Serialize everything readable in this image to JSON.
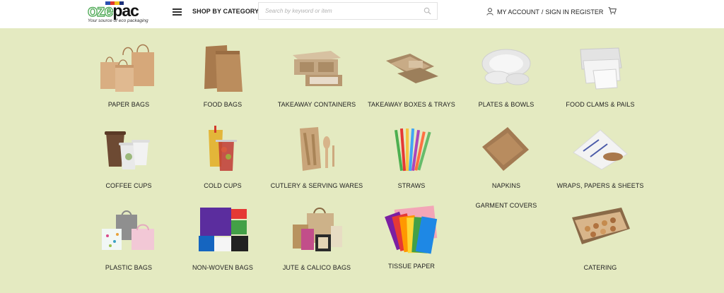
{
  "brand": {
    "logo_part1": "oze",
    "logo_part2": "pac",
    "tagline": "Your source of eco packaging",
    "square_colors": [
      "#2a4fb0",
      "#e1372b",
      "#f2c21a",
      "#1b2f78"
    ]
  },
  "header": {
    "menu_icon": "hamburger-icon",
    "shop_by_category": "SHOP BY CATEGORY",
    "search_placeholder": "Search by keyword or item",
    "search_icon": "search-icon",
    "user_icon": "user-icon",
    "my_account": "MY ACCOUNT",
    "separator": "/",
    "sign_in_register": "SIGN IN REGISTER",
    "cart_icon": "cart-icon"
  },
  "categories": [
    {
      "label": "PAPER BAGS",
      "image": "paper-bags-image"
    },
    {
      "label": "FOOD BAGS",
      "image": "food-bags-image"
    },
    {
      "label": "TAKEAWAY CONTAINERS",
      "image": "takeaway-containers-image"
    },
    {
      "label": "TAKEAWAY BOXES & TRAYS",
      "image": "takeaway-boxes-trays-image"
    },
    {
      "label": "PLATES & BOWLS",
      "image": "plates-bowls-image"
    },
    {
      "label": "FOOD CLAMS & PAILS",
      "image": "food-clams-pails-image"
    },
    {
      "label": "COFFEE CUPS",
      "image": "coffee-cups-image"
    },
    {
      "label": "COLD CUPS",
      "image": "cold-cups-image"
    },
    {
      "label": "CUTLERY & SERVING WARES",
      "image": "cutlery-serving-wares-image"
    },
    {
      "label": "STRAWS",
      "image": "straws-image"
    },
    {
      "label": "NAPKINS",
      "image": "napkins-image"
    },
    {
      "label": "WRAPS, PAPERS & SHEETS",
      "image": "wraps-papers-sheets-image"
    },
    {
      "label": "PLASTIC BAGS",
      "image": "plastic-bags-image"
    },
    {
      "label": "NON-WOVEN BAGS",
      "image": "non-woven-bags-image"
    },
    {
      "label": "JUTE & CALICO BAGS",
      "image": "jute-calico-bags-image"
    },
    {
      "label": "TISSUE PAPER",
      "image": "tissue-paper-image"
    },
    {
      "label": "GARMENT COVERS",
      "image": "garment-covers-image"
    },
    {
      "label": "CATERING",
      "image": "catering-image"
    }
  ]
}
